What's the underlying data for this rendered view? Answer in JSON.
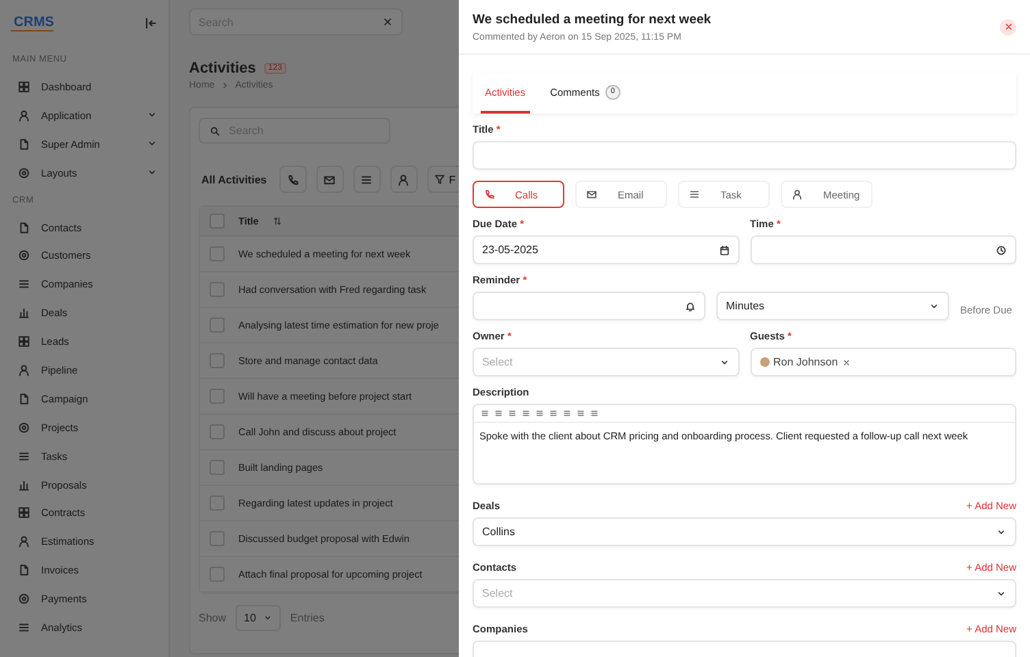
{
  "sidebar": {
    "logo": "CRMS",
    "sections": [
      {
        "heading": "MAIN MENU",
        "items": [
          {
            "label": "Dashboard",
            "expandable": false
          },
          {
            "label": "Application",
            "expandable": true
          },
          {
            "label": "Super Admin",
            "expandable": true
          },
          {
            "label": "Layouts",
            "expandable": true
          }
        ]
      },
      {
        "heading": "CRM",
        "items": [
          {
            "label": "Contacts",
            "expandable": false
          },
          {
            "label": "Customers",
            "expandable": false
          },
          {
            "label": "Companies",
            "expandable": false
          },
          {
            "label": "Deals",
            "expandable": false
          },
          {
            "label": "Leads",
            "expandable": false
          },
          {
            "label": "Pipeline",
            "expandable": false
          },
          {
            "label": "Campaign",
            "expandable": false
          },
          {
            "label": "Projects",
            "expandable": false
          },
          {
            "label": "Tasks",
            "expandable": false
          },
          {
            "label": "Proposals",
            "expandable": false
          },
          {
            "label": "Contracts",
            "expandable": false
          },
          {
            "label": "Estimations",
            "expandable": false
          },
          {
            "label": "Invoices",
            "expandable": false
          },
          {
            "label": "Payments",
            "expandable": false
          },
          {
            "label": "Analytics",
            "expandable": false
          }
        ]
      }
    ]
  },
  "topbar": {
    "search": {
      "placeholder": "Search"
    }
  },
  "page": {
    "title": "Activities",
    "count": "123",
    "breadcrumb": [
      "Home",
      "Activities"
    ]
  },
  "list": {
    "search": {
      "placeholder": "Search"
    },
    "heading": "All Activities",
    "filter_label": "F",
    "columns": [
      "Title"
    ],
    "header_checked": false,
    "rows": [
      {
        "title": "We scheduled a meeting for next week",
        "checked": false
      },
      {
        "title": "Had conversation with Fred regarding task",
        "checked": false
      },
      {
        "title": "Analysing latest time estimation for new proje",
        "checked": false
      },
      {
        "title": "Store and manage contact data",
        "checked": false
      },
      {
        "title": "Will have a meeting before project start",
        "checked": false
      },
      {
        "title": "Call John and discuss about project",
        "checked": false
      },
      {
        "title": "Built landing pages",
        "checked": false
      },
      {
        "title": "Regarding latest updates in project",
        "checked": false
      },
      {
        "title": "Discussed budget proposal with Edwin",
        "checked": false
      },
      {
        "title": "Attach final proposal for upcoming project",
        "checked": false
      }
    ],
    "footer": {
      "show": "Show",
      "page_size": "10",
      "entries": "Entries"
    }
  },
  "drawer": {
    "title": "We scheduled a meeting for next week",
    "subtitle": "Commented by Aeron on 15 Sep 2025, 11:15 PM",
    "tabs": [
      {
        "label": "Activities",
        "selected": true
      },
      {
        "label": "Comments",
        "badge": "0",
        "selected": false
      }
    ],
    "title_field": {
      "label": "Title",
      "mark": "*"
    },
    "types": [
      {
        "label": "Calls",
        "selected": true
      },
      {
        "label": "Email",
        "selected": false
      },
      {
        "label": "Task",
        "selected": false
      },
      {
        "label": "Meeting",
        "selected": false
      }
    ],
    "due_date": {
      "label": "Due Date",
      "mark": "*",
      "value": "23-05-2025"
    },
    "time": {
      "label": "Time",
      "mark": "*"
    },
    "reminder": {
      "label": "Reminder",
      "mark": "*",
      "unit": "Minutes",
      "suffix": "Before Due"
    },
    "owner": {
      "label": "Owner",
      "mark": "*",
      "placeholder": "Select"
    },
    "guests": {
      "label": "Guests",
      "mark": "*",
      "chips": [
        "Ron Johnson"
      ]
    },
    "description": {
      "label": "Description",
      "text": "Spoke with the client about CRM pricing and onboarding process. Client requested a follow-up call next week"
    },
    "relations": [
      {
        "label": "Deals",
        "action": "+ Add New",
        "value": "Collins"
      },
      {
        "label": "Contacts",
        "action": "+ Add New",
        "placeholder": "Select"
      },
      {
        "label": "Companies",
        "action": "+ Add New"
      }
    ]
  }
}
